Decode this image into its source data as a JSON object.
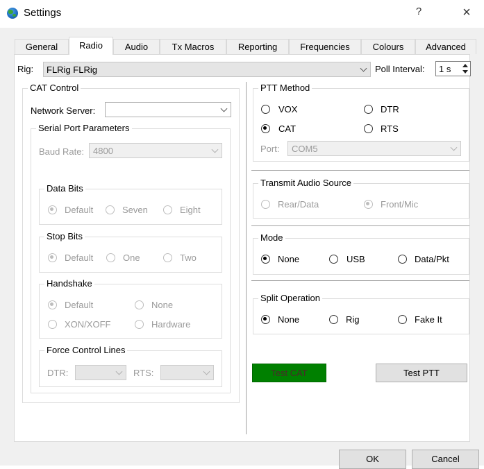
{
  "window": {
    "title": "Settings",
    "help": "?",
    "close": "×"
  },
  "tabs": [
    "General",
    "Radio",
    "Audio",
    "Tx Macros",
    "Reporting",
    "Frequencies",
    "Colours",
    "Advanced"
  ],
  "rig": {
    "label": "Rig:",
    "value": "FLRig FLRig",
    "poll_label": "Poll Interval:",
    "poll_value": "1 s"
  },
  "cat": {
    "title": "CAT Control",
    "network_label": "Network Server:",
    "network_value": "",
    "serial": {
      "title": "Serial Port Parameters",
      "baud_label": "Baud Rate:",
      "baud_value": "4800",
      "data_bits": {
        "title": "Data Bits",
        "options": [
          "Default",
          "Seven",
          "Eight"
        ]
      },
      "stop_bits": {
        "title": "Stop Bits",
        "options": [
          "Default",
          "One",
          "Two"
        ]
      },
      "handshake": {
        "title": "Handshake",
        "options": [
          "Default",
          "None",
          "XON/XOFF",
          "Hardware"
        ]
      },
      "force": {
        "title": "Force Control Lines",
        "dtr_label": "DTR:",
        "rts_label": "RTS:"
      }
    }
  },
  "ptt": {
    "title": "PTT Method",
    "options": [
      "VOX",
      "DTR",
      "CAT",
      "RTS"
    ],
    "port_label": "Port:",
    "port_value": "COM5"
  },
  "audio_source": {
    "title": "Transmit Audio Source",
    "options": [
      "Rear/Data",
      "Front/Mic"
    ]
  },
  "mode": {
    "title": "Mode",
    "options": [
      "None",
      "USB",
      "Data/Pkt"
    ]
  },
  "split": {
    "title": "Split Operation",
    "options": [
      "None",
      "Rig",
      "Fake It"
    ]
  },
  "buttons": {
    "test_cat": "Test CAT",
    "test_ptt": "Test PTT",
    "ok": "OK",
    "cancel": "Cancel"
  },
  "colors": {
    "test_cat_bg": "#008000",
    "accent": "#0078d7"
  }
}
